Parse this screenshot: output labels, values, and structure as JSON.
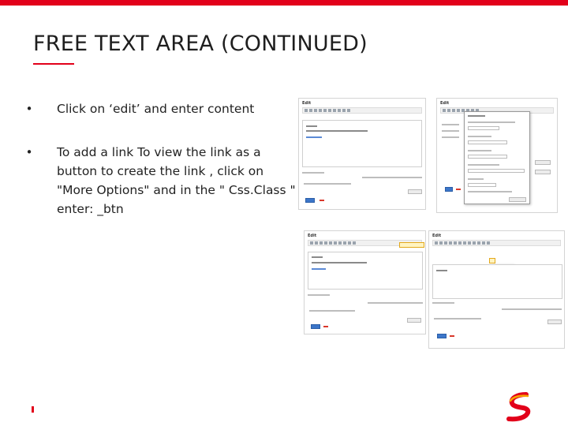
{
  "slide": {
    "title": "FREE TEXT AREA (CONTINUED)",
    "accent_color": "#e2001a"
  },
  "bullets": [
    {
      "text": "Click on ‘edit’ and enter content"
    },
    {
      "text": "To add a link To view the link as a button to create the link , click on \"More Options\" and in the \" Css.Class \" enter: _btn"
    }
  ],
  "screenshots": {
    "shot1": {
      "heading": "Edit"
    },
    "shot2": {
      "heading": "Edit"
    },
    "shot3": {
      "heading": "Edit"
    },
    "shot4": {
      "heading": "Edit"
    }
  },
  "icons": {
    "bullet": "bullet-dot-icon",
    "logo": "brand-s-logo-icon"
  }
}
